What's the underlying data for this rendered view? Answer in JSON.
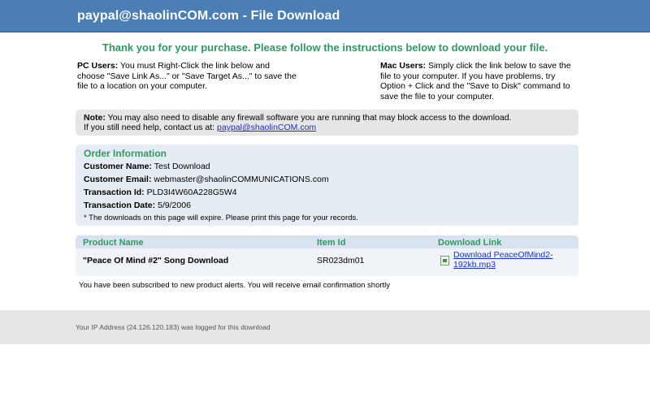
{
  "header": {
    "title": "paypal@shaolinCOM.com - File Download"
  },
  "thanks": "Thank you for your purchase. Please follow the instructions below to download your file.",
  "instructions": {
    "pc_label": "PC Users:",
    "pc_text": "You must Right-Click the link below and choose \"Save Link As...\" or \"Save Target As...\" to save the file to a location on your computer.",
    "mac_label": "Mac Users:",
    "mac_text": "Simply click the link below to save the file to your computer. If you have problems, try Option + Click and the \"Save to Disk\" command to save the file to your computer."
  },
  "note": {
    "label": "Note:",
    "line1": "You may also need to disable any firewall software you are running that may block access to the download.",
    "line2_prefix": "If you still need help, contact us at:",
    "email": "paypal@shaolinCOM.com"
  },
  "order": {
    "title": "Order Information",
    "customer_name_label": "Customer Name:",
    "customer_name": "Test Download",
    "customer_email_label": "Customer Email:",
    "customer_email": "webmaster@shaolinCOMMUNICATIONS.com",
    "transaction_id_label": "Transaction Id:",
    "transaction_id": "PLD3I4W60A228G5W4",
    "transaction_date_label": "Transaction Date:",
    "transaction_date": "5/9/2006",
    "expire_note": "* The downloads on this page will expire. Please print this page for your records."
  },
  "products": {
    "headers": {
      "name": "Product Name",
      "item_id": "Item Id",
      "download": "Download Link"
    },
    "rows": [
      {
        "name": "\"Peace Of Mind #2\" Song Download",
        "item_id": "SR023dm01",
        "link": "Download PeaceOfMind2-192kb.mp3"
      }
    ]
  },
  "subscribed": "You have been subscribed to new product alerts. You will receive email confirmation shortly",
  "footer": {
    "text": "Your IP Address (24.126.120.183) was logged for this download"
  },
  "colors": {
    "header_bg": "#4a7eb4",
    "accent_green": "#2e9960",
    "link_blue": "#1a2fd4"
  },
  "icons": {
    "download": "download-file-icon"
  }
}
